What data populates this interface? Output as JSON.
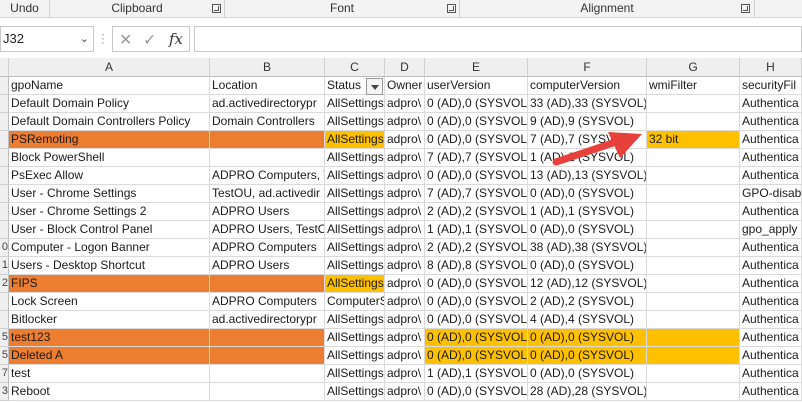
{
  "ribbon": {
    "groups": [
      {
        "label": "Undo"
      },
      {
        "label": "Clipboard"
      },
      {
        "label": "Font"
      },
      {
        "label": "Alignment"
      }
    ]
  },
  "formula_bar": {
    "name_box": "J32",
    "formula": ""
  },
  "columns": [
    {
      "letter": "A"
    },
    {
      "letter": "B"
    },
    {
      "letter": "C"
    },
    {
      "letter": "D"
    },
    {
      "letter": "E"
    },
    {
      "letter": "F"
    },
    {
      "letter": "G"
    },
    {
      "letter": "H"
    }
  ],
  "row_numbers": [
    "",
    "",
    "",
    "",
    "",
    "",
    "",
    "",
    "",
    "0",
    "1",
    "2",
    "",
    "",
    "5",
    "5",
    "7",
    "3"
  ],
  "rows": [
    [
      "gpoName",
      "Location",
      "Status",
      "Owner",
      "userVersion",
      "computerVersion",
      "wmiFilter",
      "securityFil"
    ],
    [
      "Default Domain Policy",
      "ad.activedirectorypr",
      "AllSettings",
      "adpro\\",
      "0 (AD),0 (SYSVOL)",
      "33 (AD),33 (SYSVOL)",
      "",
      "Authentica"
    ],
    [
      "Default Domain Controllers Policy",
      "Domain Controllers",
      "AllSettings",
      "adpro\\",
      "0 (AD),0 (SYSVOL)",
      "9 (AD),9 (SYSVOL)",
      "",
      "Authentica"
    ],
    [
      "PSRemoting",
      "",
      "AllSettings",
      "adpro\\",
      "0 (AD),0 (SYSVOL)",
      "7 (AD),7 (SYSVOL)",
      "32 bit",
      "Authentica"
    ],
    [
      "Block PowerShell",
      "",
      "AllSettings",
      "adpro\\",
      "7 (AD),7 (SYSVOL)",
      "1 (AD),1 (SYSVOL)",
      "",
      "Authentica"
    ],
    [
      "PsExec Allow",
      "ADPRO Computers, T",
      "AllSettings",
      "adpro\\",
      "0 (AD),0 (SYSVOL)",
      "13 (AD),13 (SYSVOL)",
      "",
      "Authentica"
    ],
    [
      "User - Chrome Settings",
      "TestOU, ad.activedir",
      "AllSettings",
      "adpro\\",
      "7 (AD),7 (SYSVOL)",
      "0 (AD),0 (SYSVOL)",
      "",
      "GPO-disab"
    ],
    [
      "User - Chrome Settings 2",
      "ADPRO Users",
      "AllSettings",
      "adpro\\",
      "2 (AD),2 (SYSVOL)",
      "1 (AD),1 (SYSVOL)",
      "",
      "Authentica"
    ],
    [
      "User - Block Control Panel",
      "ADPRO Users, TestOU",
      "AllSettings",
      "adpro\\",
      "1 (AD),1 (SYSVOL)",
      "0 (AD),0 (SYSVOL)",
      "",
      "gpo_apply"
    ],
    [
      "Computer - Logon Banner",
      "ADPRO Computers",
      "AllSettings",
      "adpro\\",
      "2 (AD),2 (SYSVOL)",
      "38 (AD),38 (SYSVOL)",
      "",
      "Authentica"
    ],
    [
      "Users - Desktop Shortcut",
      "ADPRO Users",
      "AllSettings",
      "adpro\\",
      "8 (AD),8 (SYSVOL)",
      "0 (AD),0 (SYSVOL)",
      "",
      "Authentica"
    ],
    [
      "FIPS",
      "",
      "AllSettings",
      "adpro\\",
      "0 (AD),0 (SYSVOL)",
      "12 (AD),12 (SYSVOL)",
      "",
      "Authentica"
    ],
    [
      "Lock Screen",
      "ADPRO Computers",
      "ComputerS",
      "adpro\\",
      "0 (AD),0 (SYSVOL)",
      "2 (AD),2 (SYSVOL)",
      "",
      "Authentica"
    ],
    [
      "Bitlocker",
      "ad.activedirectorypr",
      "AllSettings",
      "adpro\\",
      "0 (AD),0 (SYSVOL)",
      "4 (AD),4 (SYSVOL)",
      "",
      "Authentica"
    ],
    [
      "test123",
      "",
      "AllSettings",
      "adpro\\",
      "0 (AD),0 (SYSVOL)",
      "0 (AD),0 (SYSVOL)",
      "",
      "Authentica"
    ],
    [
      "Deleted A",
      "",
      "AllSettings",
      "adpro\\",
      "0 (AD),0 (SYSVOL)",
      "0 (AD),0 (SYSVOL)",
      "",
      "Authentica"
    ],
    [
      "test",
      "",
      "AllSettings",
      "adpro\\",
      "1 (AD),1 (SYSVOL)",
      "0 (AD),0 (SYSVOL)",
      "",
      "Authentica"
    ],
    [
      "Reboot",
      "",
      "AllSettings",
      "adpro\\",
      "0 (AD),0 (SYSVOL)",
      "28 (AD),28 (SYSVOL)",
      "",
      "Authentica"
    ]
  ],
  "highlights": {
    "orange": "#ed7d31",
    "gold": "#ffc000",
    "arrow": "#e8403a"
  },
  "icons": [
    "dialog-launcher-icon",
    "chevron-down-icon",
    "cancel-icon",
    "enter-icon",
    "function-icon",
    "filter-dropdown-icon",
    "red-arrow-annotation"
  ]
}
